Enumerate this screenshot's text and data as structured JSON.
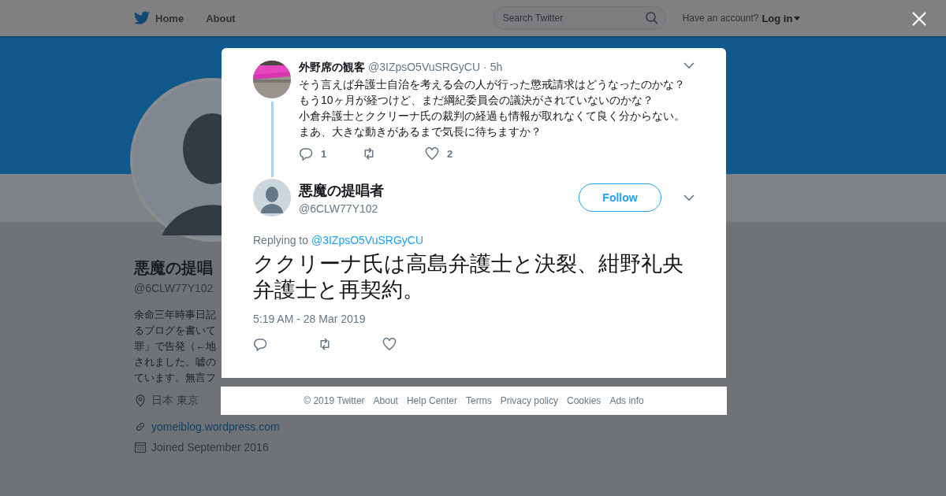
{
  "header": {
    "nav": [
      {
        "label": "Home",
        "kind": "logo"
      },
      {
        "label": "About",
        "kind": "plain"
      }
    ],
    "search": {
      "placeholder": "Search Twitter"
    },
    "account_prompt": "Have an account?",
    "login": "Log in"
  },
  "profile": {
    "name": "悪魔の提唱",
    "handle": "@6CLW77Y102",
    "bio_lines": [
      "余命三年時事日記",
      "るブログを書いて",
      "罪」で告発（←地",
      "されました。嘘の",
      "ています。無言フ"
    ],
    "location": "日本 東京",
    "link": "yomeiblog.wordpress.com",
    "joined": "Joined September 2016"
  },
  "parent_tweet": {
    "author": "外野席の観客",
    "handle": "@3IZpsO5VuSRGyCU",
    "time": "· 5h",
    "lines": [
      "そう言えば弁護士自治を考える会の人が行った懲戒請求はどうなったのかな？",
      "もう10ヶ月が経つけど、まだ綱紀委員会の議決がされていないのかな？",
      "小倉弁護士とククリーナ氏の裁判の経過も情報が取れなくて良く分からない。",
      "まあ、大きな動きがあるまで気長に待ちますか？"
    ],
    "replies": "1",
    "likes": "2"
  },
  "tweet": {
    "author": "悪魔の提唱者",
    "handle": "@6CLW77Y102",
    "follow": "Follow",
    "replying_label": "Replying to",
    "replying_to": "@3IZpsO5VuSRGyCU",
    "text": "ククリーナ氏は高島弁護士と決裂、紺野礼央弁護士と再契約。",
    "timestamp": "5:19 AM - 28 Mar 2019"
  },
  "footer": [
    "© 2019 Twitter",
    "About",
    "Help Center",
    "Terms",
    "Privacy policy",
    "Cookies",
    "Ads info"
  ]
}
